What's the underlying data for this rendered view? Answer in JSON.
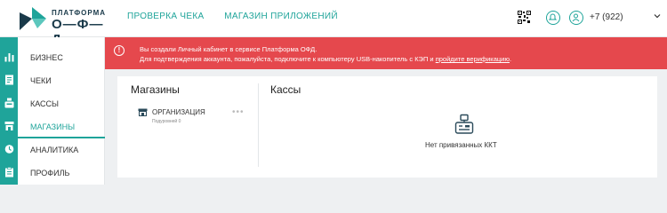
{
  "brand": {
    "line1": "ПЛАТФОРМА",
    "line2": "О—Ф—Д",
    "color": "#1fa49a"
  },
  "topnav": {
    "items": [
      "ПРОВЕРКА ЧЕКА",
      "МАГАЗИН ПРИЛОЖЕНИЙ"
    ]
  },
  "header": {
    "phone": "+7 (922)"
  },
  "sidebar": {
    "items": [
      {
        "label": "БИЗНЕС",
        "icon": "chart-icon"
      },
      {
        "label": "ЧЕКИ",
        "icon": "receipt-icon"
      },
      {
        "label": "КАССЫ",
        "icon": "cash-register-icon"
      },
      {
        "label": "МАГАЗИНЫ",
        "icon": "store-icon",
        "active": true
      },
      {
        "label": "АНАЛИТИКА",
        "icon": "clock-icon"
      },
      {
        "label": "ПРОФИЛЬ",
        "icon": "clipboard-icon"
      }
    ]
  },
  "alert": {
    "line1": "Вы создали Личный кабинет в сервисе Платформа ОФД.",
    "line2": "Для подтверждения аккаунта, пожалуйста, подключите к компьютеру USB-накопитель с КЭП и ",
    "link": "пройдите верификацию",
    "line2_end": ".",
    "color": "#e5484d"
  },
  "stores": {
    "title": "Магазины",
    "items": [
      {
        "name": "ОРГАНИЗАЦИЯ",
        "sub": "Подуровней 0",
        "menu": "•••"
      }
    ]
  },
  "kassy": {
    "title": "Кассы",
    "empty": "Нет привязанных ККТ"
  }
}
